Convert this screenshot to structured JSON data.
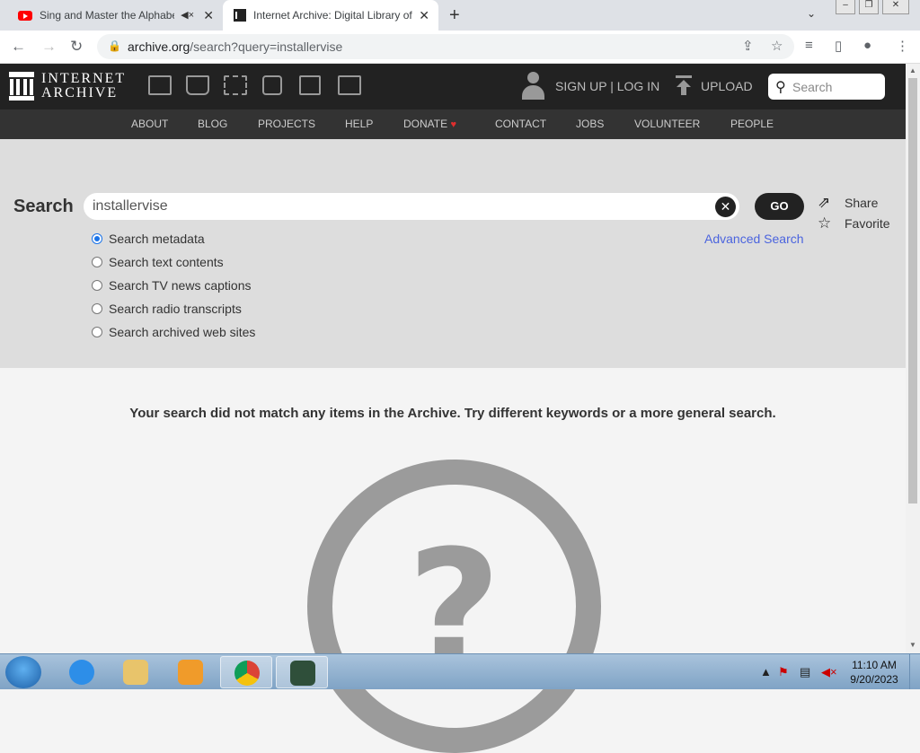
{
  "browser": {
    "tabs": [
      {
        "title": "Sing and Master the Alphabet",
        "close": "✕"
      },
      {
        "title": "Internet Archive: Digital Library of",
        "close": "✕"
      }
    ],
    "new_tab": "+",
    "url_host": "archive.org",
    "url_path": "/search?query=installervise"
  },
  "ia_header": {
    "logo_line1": "INTERNET",
    "logo_line2": "ARCHIVE",
    "signin": "SIGN UP | LOG IN",
    "upload": "UPLOAD",
    "search_placeholder": "Search",
    "nav": [
      "ABOUT",
      "BLOG",
      "PROJECTS",
      "HELP",
      "DONATE",
      "CONTACT",
      "JOBS",
      "VOLUNTEER",
      "PEOPLE"
    ]
  },
  "search": {
    "heading": "Search",
    "query": "installervise",
    "go": "GO",
    "share": "Share",
    "favorite": "Favorite",
    "advanced": "Advanced Search",
    "options": [
      {
        "label": "Search metadata",
        "selected": true
      },
      {
        "label": "Search text contents",
        "selected": false
      },
      {
        "label": "Search TV news captions",
        "selected": false
      },
      {
        "label": "Search radio transcripts",
        "selected": false
      },
      {
        "label": "Search archived web sites",
        "selected": false
      }
    ]
  },
  "results": {
    "no_match": "Your search did not match any items in the Archive. Try different keywords or a more general search.",
    "placeholder_glyph": "?"
  },
  "taskbar": {
    "time": "11:10 AM",
    "date": "9/20/2023"
  }
}
